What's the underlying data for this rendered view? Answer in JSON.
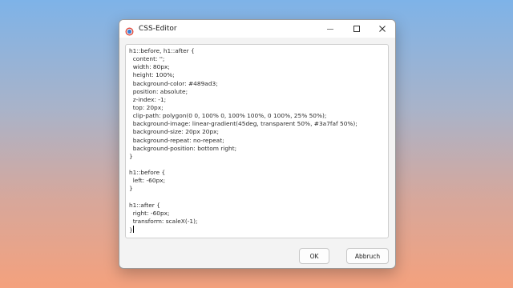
{
  "window": {
    "title": "CSS-Editor",
    "icon": "css-editor-icon"
  },
  "titlebar_buttons": {
    "minimize": "minimize-icon",
    "maximize": "maximize-icon",
    "close": "close-icon"
  },
  "editor": {
    "lines": [
      "h1::before, h1::after {",
      "  content: '';",
      "  width: 80px;",
      "  height: 100%;",
      "  background-color: #489ad3;",
      "  position: absolute;",
      "  z-index: -1;",
      "  top: 20px;",
      "  clip-path: polygon(0 0, 100% 0, 100% 100%, 0 100%, 25% 50%);",
      "  background-image: linear-gradient(45deg, transparent 50%, #3a7faf 50%);",
      "  background-size: 20px 20px;",
      "  background-repeat: no-repeat;",
      "  background-position: bottom right;",
      "}",
      "",
      "h1::before {",
      "  left: -60px;",
      "}",
      "",
      "h1::after {",
      "  right: -60px;",
      "  transform: scaleX(-1);",
      "}"
    ]
  },
  "buttons": {
    "ok": "OK",
    "cancel": "Abbruch"
  },
  "colors": {
    "icon_blue": "#3a7fd5",
    "icon_red": "#e0483a"
  }
}
